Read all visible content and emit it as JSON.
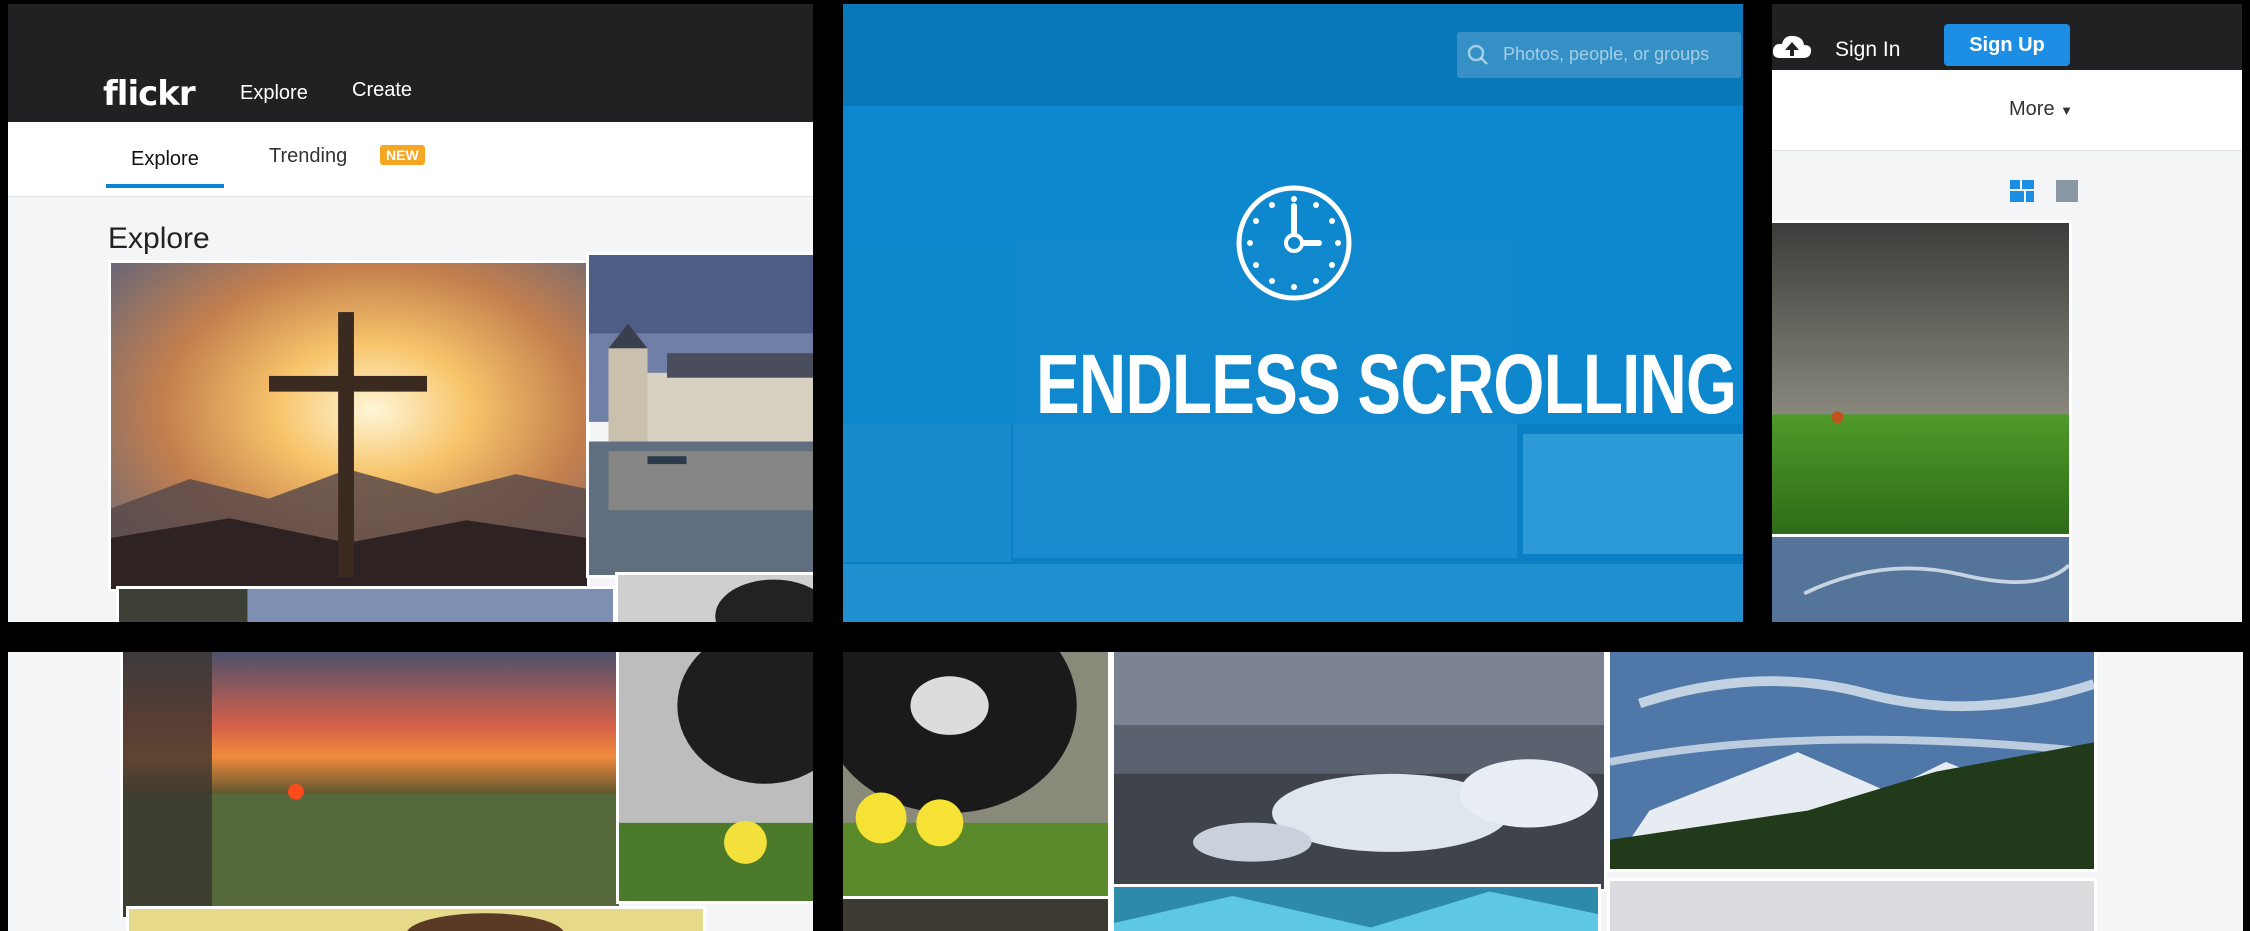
{
  "header": {
    "logo": "flickr",
    "nav_explore": "Explore",
    "nav_create": "Create",
    "sign_in": "Sign In",
    "sign_up": "Sign Up",
    "search_placeholder": "Photos, people, or groups"
  },
  "subnav": {
    "tab_explore": "Explore",
    "tab_trending": "Trending",
    "badge_new": "NEW",
    "more": "More"
  },
  "page": {
    "heading": "Explore"
  },
  "overlay": {
    "title": "ENDLESS SCROLLING",
    "icon": "clock-icon"
  },
  "colors": {
    "topbar": "#212124",
    "accent": "#0a83d0",
    "signup": "#1c8ee6",
    "badge": "#f5a623",
    "overlay": "#0b8bd3"
  }
}
